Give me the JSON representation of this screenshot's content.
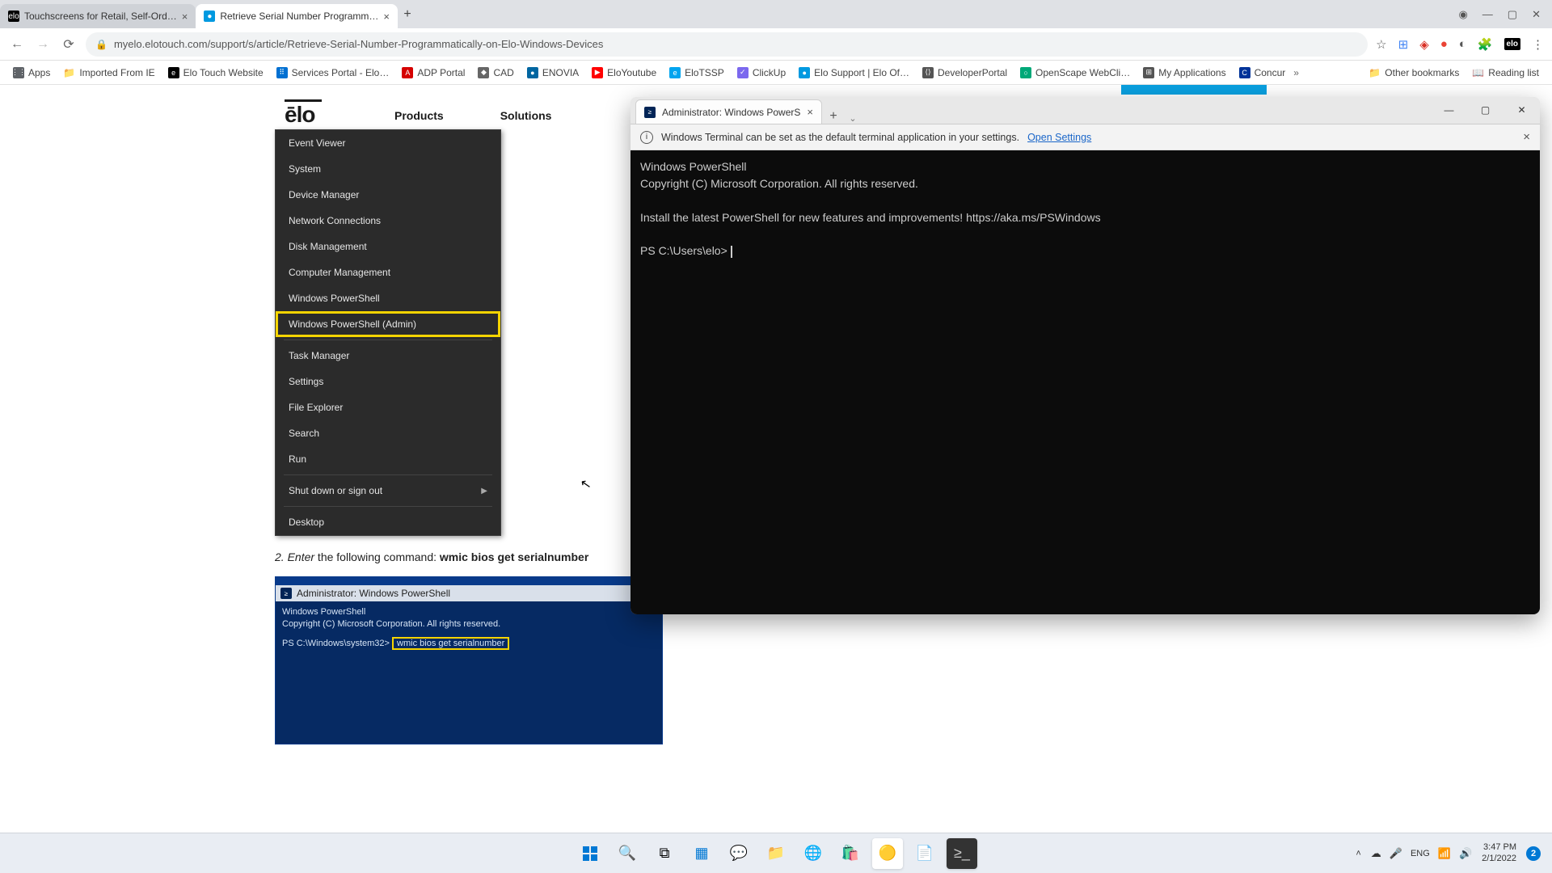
{
  "chrome": {
    "tabs": [
      {
        "favicon_bg": "#000",
        "favicon_text": "elo",
        "favicon_color": "#fff",
        "title": "Touchscreens for Retail, Self-Ord…"
      },
      {
        "favicon_bg": "#0099e0",
        "favicon_text": "●",
        "favicon_color": "#fff",
        "title": "Retrieve Serial Number Programm…"
      }
    ],
    "url": "myelo.elotouch.com/support/s/article/Retrieve-Serial-Number-Programmatically-on-Elo-Windows-Devices",
    "bookmarks": [
      {
        "icon": "⋮⋮⋮",
        "bg": "#5f6368",
        "label": "Apps"
      },
      {
        "icon": "📁",
        "bg": "",
        "label": "Imported From IE"
      },
      {
        "icon": "elo",
        "bg": "#000",
        "label": "Elo Touch Website"
      },
      {
        "icon": "⠿",
        "bg": "#0070d2",
        "label": "Services Portal - Elo…"
      },
      {
        "icon": "ᴀᴅᴘ",
        "bg": "#d50000",
        "label": "ADP Portal"
      },
      {
        "icon": "◆",
        "bg": "#666",
        "label": "CAD"
      },
      {
        "icon": "●",
        "bg": "#0066a1",
        "label": "ENOVIA"
      },
      {
        "icon": "▶",
        "bg": "#ff0000",
        "label": "EloYoutube"
      },
      {
        "icon": "e",
        "bg": "#00a4ef",
        "label": "EloTSSP"
      },
      {
        "icon": "✓",
        "bg": "#7b68ee",
        "label": "ClickUp"
      },
      {
        "icon": "●",
        "bg": "#0099e0",
        "label": "Elo Support | Elo Of…"
      },
      {
        "icon": "⟨⟩",
        "bg": "#555",
        "label": "DeveloperPortal"
      },
      {
        "icon": "○",
        "bg": "#00a878",
        "label": "OpenScape WebCli…"
      },
      {
        "icon": "⊞",
        "bg": "#555",
        "label": "My Applications"
      },
      {
        "icon": "C",
        "bg": "#003399",
        "label": "Concur"
      }
    ],
    "other_bookmarks": "Other bookmarks",
    "reading_list": "Reading list"
  },
  "elo_site": {
    "logo": "ēlo",
    "nav": [
      "Products",
      "Solutions"
    ]
  },
  "winx": {
    "items_top": [
      "Event Viewer",
      "System",
      "Device Manager",
      "Network Connections",
      "Disk Management",
      "Computer Management",
      "Windows PowerShell"
    ],
    "highlighted": "Windows PowerShell (Admin)",
    "items_mid": [
      "Task Manager",
      "Settings",
      "File Explorer",
      "Search",
      "Run"
    ],
    "shutdown": "Shut down or sign out",
    "desktop": "Desktop"
  },
  "article": {
    "step_num": "2.",
    "step_em": "Enter",
    "step_text": " the following command: ",
    "step_cmd": "wmic bios get serialnumber"
  },
  "ps_shot": {
    "title": "Administrator: Windows PowerShell",
    "line1": "Windows PowerShell",
    "line2": "Copyright (C) Microsoft Corporation. All rights reserved.",
    "prompt": "PS C:\\Windows\\system32>",
    "cmd": "wmic bios get serialnumber"
  },
  "terminal": {
    "tab_title": "Administrator: Windows PowerS",
    "info_text": "Windows Terminal can be set as the default terminal application in your settings.",
    "info_link": "Open Settings",
    "body_line1": "Windows PowerShell",
    "body_line2": "Copyright (C) Microsoft Corporation. All rights reserved.",
    "body_line3": "Install the latest PowerShell for new features and improvements! https://aka.ms/PSWindows",
    "prompt": "PS C:\\Users\\elo>"
  },
  "taskbar": {
    "time": "3:47 PM",
    "date": "2/1/2022",
    "notif_count": "2"
  }
}
